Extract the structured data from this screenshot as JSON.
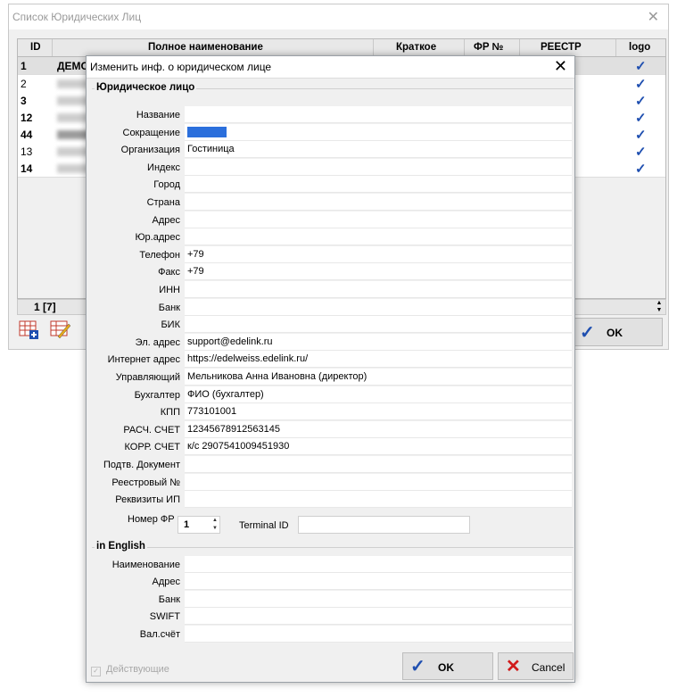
{
  "background_window": {
    "title": "Список Юридических Лиц",
    "columns": [
      "ID",
      "Полное наименование",
      "Краткое",
      "ФР №",
      "РЕЕСТР",
      "logo"
    ],
    "rows": [
      {
        "id": "1",
        "name": "ДЕМО",
        "logo": true
      },
      {
        "id": "2",
        "name": "",
        "logo": true
      },
      {
        "id": "3",
        "name": "",
        "logo": true
      },
      {
        "id": "12",
        "name": "",
        "logo": true
      },
      {
        "id": "44",
        "name": "",
        "logo": true
      },
      {
        "id": "13",
        "name": "",
        "logo": true
      },
      {
        "id": "14",
        "name": "",
        "logo": true
      }
    ],
    "footer": "1 [7]",
    "ok_label": "OK"
  },
  "dialog": {
    "title": "Изменить инф. о юридическом лице",
    "group_main": "Юридическое лицо",
    "fields": [
      {
        "label": "Название",
        "value": ""
      },
      {
        "label": "Сокращение",
        "value": "",
        "selected": true
      },
      {
        "label": "Организация",
        "value": "Гостиница"
      },
      {
        "label": "Индекс",
        "value": ""
      },
      {
        "label": "Город",
        "value": ""
      },
      {
        "label": "Страна",
        "value": ""
      },
      {
        "label": "Адрес",
        "value": ""
      },
      {
        "label": "Юр.адрес",
        "value": ""
      },
      {
        "label": "Телефон",
        "value": "+79"
      },
      {
        "label": "Факс",
        "value": "+79"
      },
      {
        "label": "ИНН",
        "value": ""
      },
      {
        "label": "Банк",
        "value": ""
      },
      {
        "label": "БИК",
        "value": ""
      },
      {
        "label": "Эл. адрес",
        "value": "support@edelink.ru"
      },
      {
        "label": "Интернет адрес",
        "value": "https://edelweiss.edelink.ru/"
      },
      {
        "label": "Управляющий",
        "value": "Мельникова Анна Ивановна  (директор)"
      },
      {
        "label": "Бухгалтер",
        "value": "ФИО (бухгалтер)"
      },
      {
        "label": "КПП",
        "value": "773101001"
      },
      {
        "label": "РАСЧ. СЧЕТ",
        "value": "12345678912563145"
      },
      {
        "label": "КОРР. СЧЕТ",
        "value": "к/с 2907541009451930"
      },
      {
        "label": "Подтв. Документ",
        "value": ""
      },
      {
        "label": "Реестровый №",
        "value": ""
      },
      {
        "label": "Реквизиты ИП",
        "value": ""
      }
    ],
    "fr_number_label": "Номер ФР",
    "fr_number": "1",
    "terminal_label": "Terminal ID",
    "terminal_value": "",
    "group_english": "in English",
    "english_fields": [
      {
        "label": "Наименование",
        "value": ""
      },
      {
        "label": "Адрес",
        "value": ""
      },
      {
        "label": "Банк",
        "value": ""
      },
      {
        "label": "SWIFT",
        "value": ""
      },
      {
        "label": "Вал.счёт",
        "value": ""
      }
    ],
    "active_label": "Действующие",
    "ok_label": "OK",
    "cancel_label": "Cancel"
  },
  "colors": {
    "accent": "#1f4fb0",
    "cancel": "#d11a1a",
    "selection": "#2b6fdc"
  }
}
